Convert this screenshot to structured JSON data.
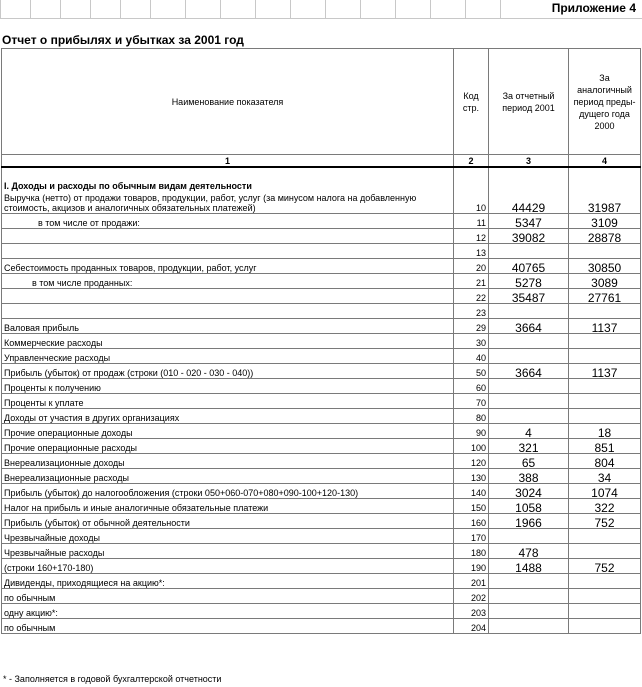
{
  "appendix": "Приложение 4",
  "title": "Отчет о прибылях и убытках за 2001 год",
  "header": {
    "name": "Наименование показателя",
    "code": "Код стр.",
    "current": "За отчетный период 2001",
    "previous": "За аналогичный период преды-дущего года 2000",
    "n1": "1",
    "n2": "2",
    "n3": "3",
    "n4": "4"
  },
  "section1": "I. Доходы и расходы по обычным видам деятельности",
  "rows": [
    {
      "label": "Выручка (нетто) от продажи товаров, продукции, работ, услуг (за минусом налога на добавленную стоимость, акцизов и аналогичных обязательных платежей)",
      "code": "10",
      "cur": "44429",
      "prev": "31987"
    },
    {
      "label": "в том числе от продажи:",
      "code": "11",
      "cur": "5347",
      "prev": "3109"
    },
    {
      "label": "",
      "code": "12",
      "cur": "39082",
      "prev": "28878"
    },
    {
      "label": "",
      "code": "13",
      "cur": "",
      "prev": ""
    },
    {
      "label": "Себестоимость проданных товаров, продукции, работ, услуг",
      "code": "20",
      "cur": "40765",
      "prev": "30850"
    },
    {
      "label": "в том числе проданных:",
      "code": "21",
      "cur": "5278",
      "prev": "3089"
    },
    {
      "label": "",
      "code": "22",
      "cur": "35487",
      "prev": "27761"
    },
    {
      "label": "",
      "code": "23",
      "cur": "",
      "prev": ""
    },
    {
      "label": "Валовая прибыль",
      "code": "29",
      "cur": "3664",
      "prev": "1137"
    },
    {
      "label": "Коммерческие расходы",
      "code": "30",
      "cur": "",
      "prev": ""
    },
    {
      "label": "Управленческие расходы",
      "code": "40",
      "cur": "",
      "prev": ""
    },
    {
      "label": "Прибыль (убыток) от продаж (строки (010 - 020 - 030 - 040))",
      "code": "50",
      "cur": "3664",
      "prev": "1137"
    },
    {
      "label": "Проценты к получению",
      "code": "60",
      "cur": "",
      "prev": ""
    },
    {
      "label": "Проценты к уплате",
      "code": "70",
      "cur": "",
      "prev": ""
    },
    {
      "label": "Доходы от участия в других организациях",
      "code": "80",
      "cur": "",
      "prev": ""
    },
    {
      "label": "Прочие операционные доходы",
      "code": "90",
      "cur": "4",
      "prev": "18"
    },
    {
      "label": "Прочие операционные расходы",
      "code": "100",
      "cur": "321",
      "prev": "851"
    },
    {
      "label": "Внереализационные доходы",
      "code": "120",
      "cur": "65",
      "prev": "804"
    },
    {
      "label": "Внереализационные расходы",
      "code": "130",
      "cur": "388",
      "prev": "34"
    },
    {
      "label": "Прибыль (убыток) до налогообложения (строки 050+060-070+080+090-100+120-130)",
      "code": "140",
      "cur": "3024",
      "prev": "1074"
    },
    {
      "label": "Налог на прибыль и иные аналогичные обязательные платежи",
      "code": "150",
      "cur": "1058",
      "prev": "322"
    },
    {
      "label": "Прибыль (убыток) от обычной деятельности",
      "code": "160",
      "cur": "1966",
      "prev": "752"
    },
    {
      "label": "Чрезвычайные доходы",
      "code": "170",
      "cur": "",
      "prev": ""
    },
    {
      "label": "Чрезвычайные расходы",
      "code": "180",
      "cur": "478",
      "prev": ""
    },
    {
      "label": "(строки 160+170-180)",
      "code": "190",
      "cur": "1488",
      "prev": "752"
    },
    {
      "label": "Дивиденды, приходящиеся на акцию*:",
      "code": "201",
      "cur": "",
      "prev": ""
    },
    {
      "label": "по обычным",
      "code": "202",
      "cur": "",
      "prev": ""
    },
    {
      "label": "одну акцию*:",
      "code": "203",
      "cur": "",
      "prev": ""
    },
    {
      "label": "по обычным",
      "code": "204",
      "cur": "",
      "prev": ""
    }
  ],
  "footnote": "* - Заполняется в годовой бухгалтерской отчетности"
}
